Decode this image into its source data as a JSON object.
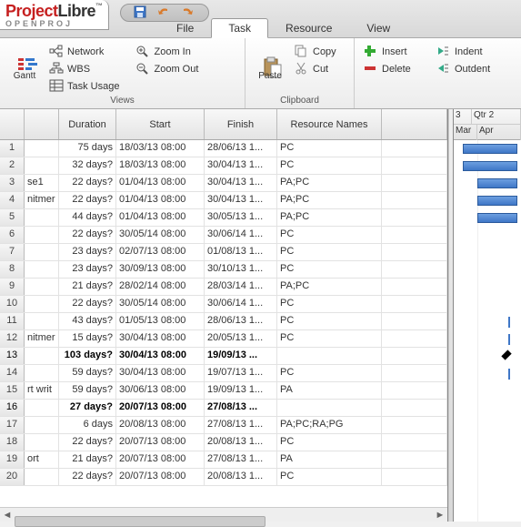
{
  "app": {
    "logo_part1": "Project",
    "logo_part2": "Libre",
    "logo_tm": "™",
    "logo_sub": "OPENPROJ"
  },
  "tabs": {
    "file": "File",
    "task": "Task",
    "resource": "Resource",
    "view": "View",
    "active": "task"
  },
  "ribbon": {
    "views": {
      "title": "Views",
      "gantt": "Gantt",
      "network": "Network",
      "wbs": "WBS",
      "task_usage": "Task Usage",
      "zoom_in": "Zoom In",
      "zoom_out": "Zoom Out"
    },
    "clipboard": {
      "title": "Clipboard",
      "paste": "Paste",
      "copy": "Copy",
      "cut": "Cut"
    },
    "edit": {
      "insert": "Insert",
      "delete": "Delete",
      "indent": "Indent",
      "outdent": "Outdent"
    }
  },
  "sheet": {
    "columns": {
      "duration": "Duration",
      "start": "Start",
      "finish": "Finish",
      "resource_names": "Resource Names"
    },
    "rows": [
      {
        "id": "1",
        "name": "",
        "dur": "75 days",
        "start": "18/03/13 08:00",
        "finish": "28/06/13 1...",
        "res": "PC",
        "bold": false
      },
      {
        "id": "2",
        "name": "",
        "dur": "32 days?",
        "start": "18/03/13 08:00",
        "finish": "30/04/13 1...",
        "res": "PC",
        "bold": false
      },
      {
        "id": "3",
        "name": "se1",
        "dur": "22 days?",
        "start": "01/04/13 08:00",
        "finish": "30/04/13 1...",
        "res": "PA;PC",
        "bold": false
      },
      {
        "id": "4",
        "name": "nitmer",
        "dur": "22 days?",
        "start": "01/04/13 08:00",
        "finish": "30/04/13 1...",
        "res": "PA;PC",
        "bold": false
      },
      {
        "id": "5",
        "name": "",
        "dur": "44 days?",
        "start": "01/04/13 08:00",
        "finish": "30/05/13 1...",
        "res": "PA;PC",
        "bold": false
      },
      {
        "id": "6",
        "name": "",
        "dur": "22 days?",
        "start": "30/05/14 08:00",
        "finish": "30/06/14 1...",
        "res": "PC",
        "bold": false
      },
      {
        "id": "7",
        "name": "",
        "dur": "23 days?",
        "start": "02/07/13 08:00",
        "finish": "01/08/13 1...",
        "res": "PC",
        "bold": false
      },
      {
        "id": "8",
        "name": "",
        "dur": "23 days?",
        "start": "30/09/13 08:00",
        "finish": "30/10/13 1...",
        "res": "PC",
        "bold": false
      },
      {
        "id": "9",
        "name": "",
        "dur": "21 days?",
        "start": "28/02/14 08:00",
        "finish": "28/03/14 1...",
        "res": "PA;PC",
        "bold": false
      },
      {
        "id": "10",
        "name": "",
        "dur": "22 days?",
        "start": "30/05/14 08:00",
        "finish": "30/06/14 1...",
        "res": "PC",
        "bold": false
      },
      {
        "id": "11",
        "name": "",
        "dur": "43 days?",
        "start": "01/05/13 08:00",
        "finish": "28/06/13 1...",
        "res": "PC",
        "bold": false
      },
      {
        "id": "12",
        "name": "nitmer",
        "dur": "15 days?",
        "start": "30/04/13 08:00",
        "finish": "20/05/13 1...",
        "res": "PC",
        "bold": false
      },
      {
        "id": "13",
        "name": "",
        "dur": "103 days?",
        "start": "30/04/13 08:00",
        "finish": "19/09/13 ...",
        "res": "",
        "bold": true
      },
      {
        "id": "14",
        "name": "",
        "dur": "59 days?",
        "start": "30/04/13 08:00",
        "finish": "19/07/13 1...",
        "res": "PC",
        "bold": false
      },
      {
        "id": "15",
        "name": "rt writ",
        "dur": "59 days?",
        "start": "30/06/13 08:00",
        "finish": "19/09/13 1...",
        "res": "PA",
        "bold": false
      },
      {
        "id": "16",
        "name": "",
        "dur": "27 days?",
        "start": "20/07/13 08:00",
        "finish": "27/08/13 ...",
        "res": "",
        "bold": true
      },
      {
        "id": "17",
        "name": "",
        "dur": "6 days",
        "start": "20/08/13 08:00",
        "finish": "27/08/13 1...",
        "res": "PA;PC;RA;PG",
        "bold": false
      },
      {
        "id": "18",
        "name": "",
        "dur": "22 days?",
        "start": "20/07/13 08:00",
        "finish": "20/08/13 1...",
        "res": "PC",
        "bold": false
      },
      {
        "id": "19",
        "name": "ort",
        "dur": "21 days?",
        "start": "20/07/13 08:00",
        "finish": "27/08/13 1...",
        "res": "PA",
        "bold": false
      },
      {
        "id": "20",
        "name": "",
        "dur": "22 days?",
        "start": "20/07/13 08:00",
        "finish": "20/08/13 1...",
        "res": "PC",
        "bold": false
      }
    ]
  },
  "gantt_header": {
    "top_left": "3",
    "top_right": "Qtr 2",
    "bot_left": "Mar",
    "bot_right": "Apr"
  }
}
